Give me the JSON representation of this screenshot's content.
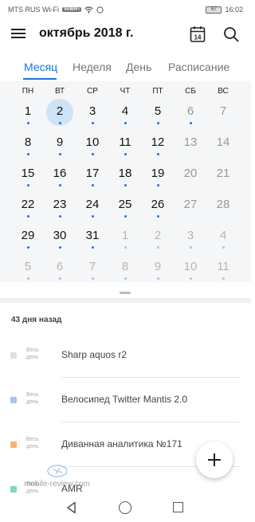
{
  "status_bar": {
    "carrier": "MTS RUS Wi-Fi",
    "network_badge": "VoWiFi",
    "battery": "67",
    "time": "16:02"
  },
  "header": {
    "title": "октябрь 2018 г.",
    "today_day": "14"
  },
  "tabs": [
    {
      "label": "Месяц",
      "active": true
    },
    {
      "label": "Неделя",
      "active": false
    },
    {
      "label": "День",
      "active": false
    },
    {
      "label": "Расписание",
      "active": false
    }
  ],
  "calendar": {
    "weekdays": [
      "ПН",
      "ВТ",
      "СР",
      "ЧТ",
      "ПТ",
      "СБ",
      "ВС"
    ],
    "today": "2",
    "weeks": [
      [
        {
          "d": "1",
          "s": "cur",
          "dot": true
        },
        {
          "d": "2",
          "s": "today",
          "dot": true
        },
        {
          "d": "3",
          "s": "cur",
          "dot": true
        },
        {
          "d": "4",
          "s": "cur",
          "dot": true
        },
        {
          "d": "5",
          "s": "cur",
          "dot": true
        },
        {
          "d": "6",
          "s": "wknd",
          "dot": true
        },
        {
          "d": "7",
          "s": "wknd",
          "dot": false
        }
      ],
      [
        {
          "d": "8",
          "s": "cur",
          "dot": true
        },
        {
          "d": "9",
          "s": "cur",
          "dot": true
        },
        {
          "d": "10",
          "s": "cur",
          "dot": true
        },
        {
          "d": "11",
          "s": "cur",
          "dot": true
        },
        {
          "d": "12",
          "s": "cur",
          "dot": true
        },
        {
          "d": "13",
          "s": "wknd",
          "dot": false
        },
        {
          "d": "14",
          "s": "wknd",
          "dot": false
        }
      ],
      [
        {
          "d": "15",
          "s": "cur",
          "dot": true
        },
        {
          "d": "16",
          "s": "cur",
          "dot": true
        },
        {
          "d": "17",
          "s": "cur",
          "dot": true
        },
        {
          "d": "18",
          "s": "cur",
          "dot": true
        },
        {
          "d": "19",
          "s": "cur",
          "dot": true
        },
        {
          "d": "20",
          "s": "wknd",
          "dot": false
        },
        {
          "d": "21",
          "s": "wknd",
          "dot": false
        }
      ],
      [
        {
          "d": "22",
          "s": "cur",
          "dot": true
        },
        {
          "d": "23",
          "s": "cur",
          "dot": true
        },
        {
          "d": "24",
          "s": "cur",
          "dot": true
        },
        {
          "d": "25",
          "s": "cur",
          "dot": true
        },
        {
          "d": "26",
          "s": "cur",
          "dot": true
        },
        {
          "d": "27",
          "s": "wknd",
          "dot": false
        },
        {
          "d": "28",
          "s": "wknd",
          "dot": false
        }
      ],
      [
        {
          "d": "29",
          "s": "cur",
          "dot": true
        },
        {
          "d": "30",
          "s": "cur",
          "dot": true
        },
        {
          "d": "31",
          "s": "cur",
          "dot": true
        },
        {
          "d": "1",
          "s": "other",
          "dot": true
        },
        {
          "d": "2",
          "s": "other",
          "dot": true
        },
        {
          "d": "3",
          "s": "other",
          "dot": true
        },
        {
          "d": "4",
          "s": "other",
          "dot": true
        }
      ],
      [
        {
          "d": "5",
          "s": "other",
          "dot": true
        },
        {
          "d": "6",
          "s": "other",
          "dot": true
        },
        {
          "d": "7",
          "s": "other",
          "dot": true
        },
        {
          "d": "8",
          "s": "other",
          "dot": true
        },
        {
          "d": "9",
          "s": "other",
          "dot": true
        },
        {
          "d": "10",
          "s": "other",
          "dot": true
        },
        {
          "d": "11",
          "s": "other",
          "dot": true
        }
      ]
    ]
  },
  "events": {
    "section_label": "43 дня назад",
    "allday_label": "Весь день",
    "items": [
      {
        "title": "Sharp aquos r2",
        "color": "#e0e0e0"
      },
      {
        "title": "Велосипед Twitter Mantis 2.0",
        "color": "#a8c4ee"
      },
      {
        "title": "Диванная аналитика №171",
        "color": "#f5b37a"
      },
      {
        "title": "AMR",
        "color": "#7fdcb0"
      }
    ]
  },
  "fab_icon": "plus-icon",
  "watermark": "mobile-review.com",
  "colors": {
    "accent": "#1a73e8",
    "today_bg": "#cfe3f7"
  }
}
